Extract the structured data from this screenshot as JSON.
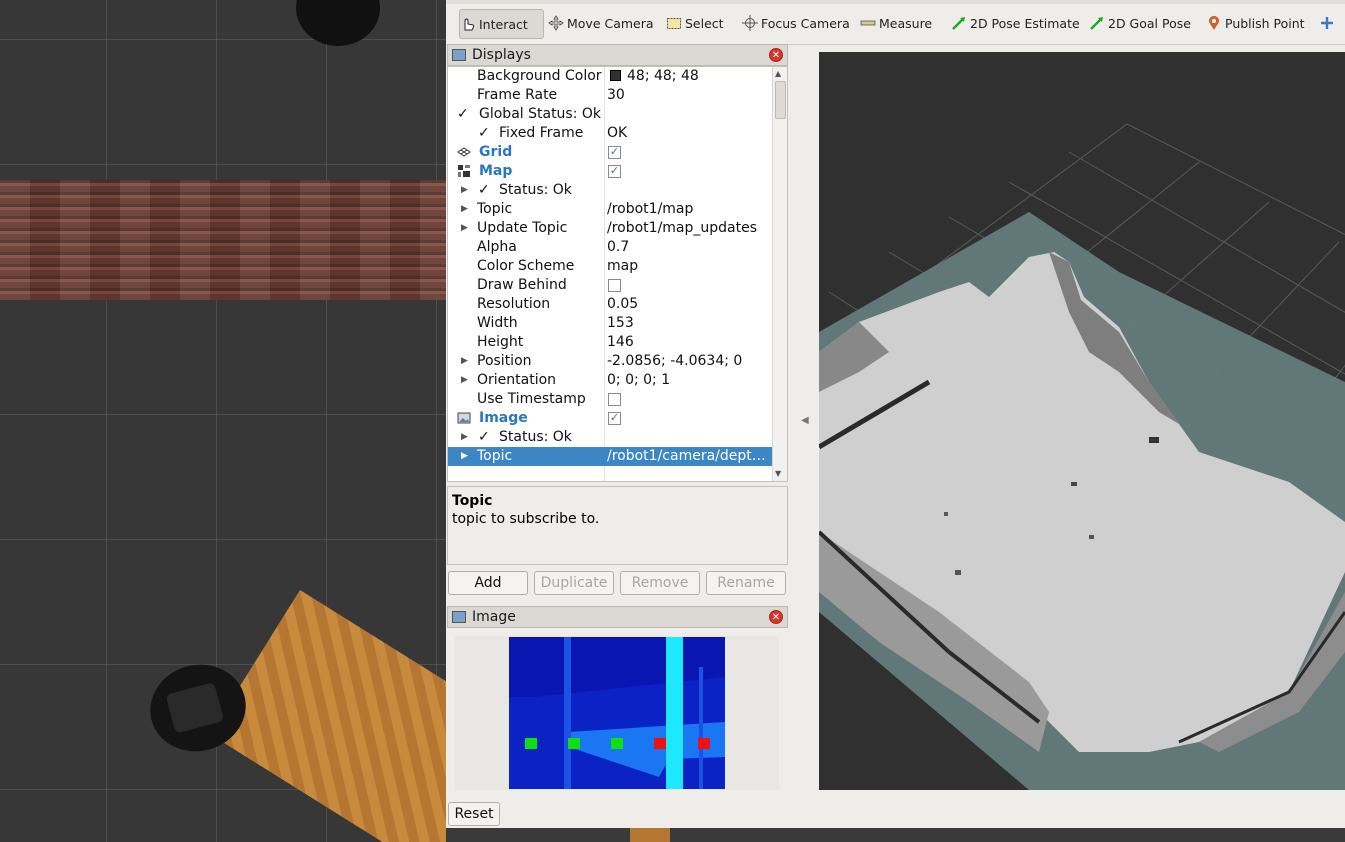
{
  "toolbar": {
    "tools": [
      "Interact",
      "Move Camera",
      "Select",
      "Focus Camera",
      "Measure",
      "2D Pose Estimate",
      "2D Goal Pose",
      "Publish Point"
    ]
  },
  "displays": {
    "title": "Displays",
    "rows": [
      {
        "label": "Background Color",
        "value": "48; 48; 48"
      },
      {
        "label": "Frame Rate",
        "value": "30"
      },
      {
        "label": "Global Status: Ok",
        "value": ""
      },
      {
        "label": "Fixed Frame",
        "value": "OK"
      },
      {
        "label": "Grid",
        "value": ""
      },
      {
        "label": "Map",
        "value": ""
      },
      {
        "label": "Status: Ok",
        "value": ""
      },
      {
        "label": "Topic",
        "value": "/robot1/map"
      },
      {
        "label": "Update Topic",
        "value": "/robot1/map_updates"
      },
      {
        "label": "Alpha",
        "value": "0.7"
      },
      {
        "label": "Color Scheme",
        "value": "map"
      },
      {
        "label": "Draw Behind",
        "value": ""
      },
      {
        "label": "Resolution",
        "value": "0.05"
      },
      {
        "label": "Width",
        "value": "153"
      },
      {
        "label": "Height",
        "value": "146"
      },
      {
        "label": "Position",
        "value": "-2.0856; -4.0634; 0"
      },
      {
        "label": "Orientation",
        "value": "0; 0; 0; 1"
      },
      {
        "label": "Use Timestamp",
        "value": ""
      },
      {
        "label": "Image",
        "value": ""
      },
      {
        "label": "Status: Ok",
        "value": ""
      },
      {
        "label": "Topic",
        "value": "/robot1/camera/dept…"
      }
    ],
    "checks": {
      "grid": true,
      "map": true,
      "draw_behind": false,
      "use_timestamp": false,
      "image": true
    },
    "background_swatch": "#303030"
  },
  "description": {
    "heading": "Topic",
    "text": "topic to subscribe to."
  },
  "buttons": {
    "add": "Add",
    "duplicate": "Duplicate",
    "remove": "Remove",
    "rename": "Rename",
    "reset": "Reset"
  },
  "image_panel": {
    "title": "Image"
  },
  "colors": {
    "selection": "#3d86c6",
    "display_name": "#2b76c1",
    "status_ok": "#2f8a2f"
  }
}
